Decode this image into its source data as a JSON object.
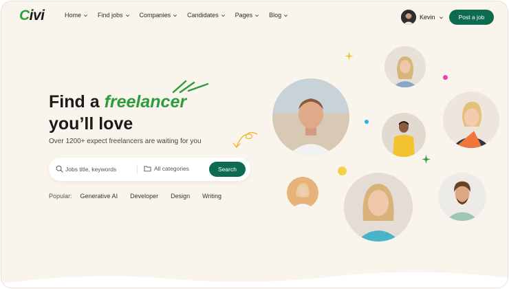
{
  "header": {
    "logo": {
      "prefix": "C",
      "rest": "ivi"
    },
    "nav": [
      {
        "label": "Home"
      },
      {
        "label": "Find jobs"
      },
      {
        "label": "Companies"
      },
      {
        "label": "Candidates"
      },
      {
        "label": "Pages"
      },
      {
        "label": "Blog"
      }
    ],
    "user": {
      "name": "Kevin"
    },
    "post_job_label": "Post a job"
  },
  "hero": {
    "title_prefix": "Find a",
    "title_accent": "freelancer",
    "title_line2": "you’ll  love",
    "subtitle": "Over 1200+ expect freelancers are waiting for you"
  },
  "search": {
    "keyword_placeholder": "Jobs title, keywords",
    "keyword_value": "",
    "category_selected": "All categories",
    "button_label": "Search"
  },
  "popular": {
    "label": "Popular:",
    "tags": [
      "Generative AI",
      "Developer",
      "Design",
      "Writing"
    ]
  },
  "colors": {
    "brand_green": "#0f6b4f",
    "accent_green": "#2e9b3d",
    "background": "#faf5ec"
  },
  "icons": [
    "search-icon",
    "folder-icon",
    "chevron-down-icon",
    "sparkle-icon",
    "curved-arrow-icon"
  ]
}
